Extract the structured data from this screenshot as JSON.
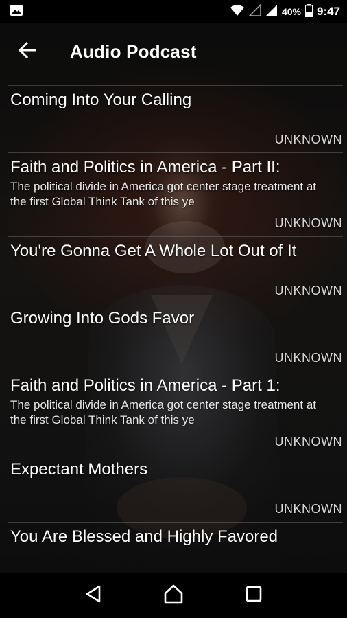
{
  "status_bar": {
    "notification_icon": "image-icon",
    "wifi_icon": "wifi-icon",
    "no_sim_icon": "no-signal-icon",
    "signal_icon": "cell-signal-icon",
    "battery_percent": "40%",
    "battery_icon": "battery-icon",
    "time": "9:47"
  },
  "app_bar": {
    "back_icon": "arrow-back-icon",
    "title": "Audio Podcast"
  },
  "episodes": [
    {
      "title": "Coming Into Your Calling",
      "description": "",
      "author": "UNKNOWN"
    },
    {
      "title": "Faith and Politics in America - Part II:",
      "description": "The political divide in America got center stage treatment at the first Global Think Tank of this ye",
      "author": "UNKNOWN"
    },
    {
      "title": "You're Gonna Get A Whole Lot Out of It",
      "description": "",
      "author": "UNKNOWN"
    },
    {
      "title": "Growing Into Gods Favor",
      "description": "",
      "author": "UNKNOWN"
    },
    {
      "title": "Faith and Politics in America - Part 1:",
      "description": "The political divide in America got center stage treatment at the first Global Think Tank of this ye",
      "author": "UNKNOWN"
    },
    {
      "title": "Expectant Mothers",
      "description": "",
      "author": "UNKNOWN"
    },
    {
      "title": "You Are Blessed and Highly Favored",
      "description": "",
      "author": ""
    }
  ],
  "nav_bar": {
    "back_icon": "triangle-back-icon",
    "home_icon": "home-icon",
    "recents_icon": "recents-icon"
  }
}
